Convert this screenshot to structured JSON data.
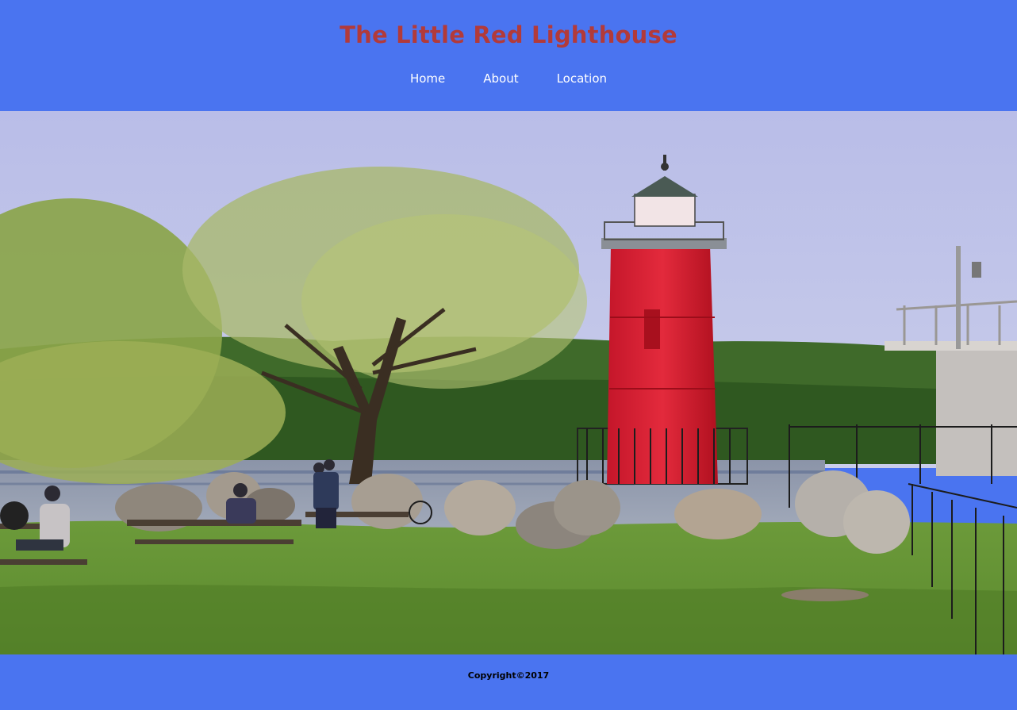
{
  "header": {
    "title": "The Little Red Lighthouse",
    "nav": [
      {
        "label": "Home"
      },
      {
        "label": "About"
      },
      {
        "label": "Location"
      }
    ]
  },
  "hero": {
    "icon": "lighthouse-photo"
  },
  "footer": {
    "copyright": "Copyright©2017"
  },
  "colors": {
    "background": "#4a74f0",
    "title": "#b23a3a",
    "nav_text": "#ffffff"
  }
}
